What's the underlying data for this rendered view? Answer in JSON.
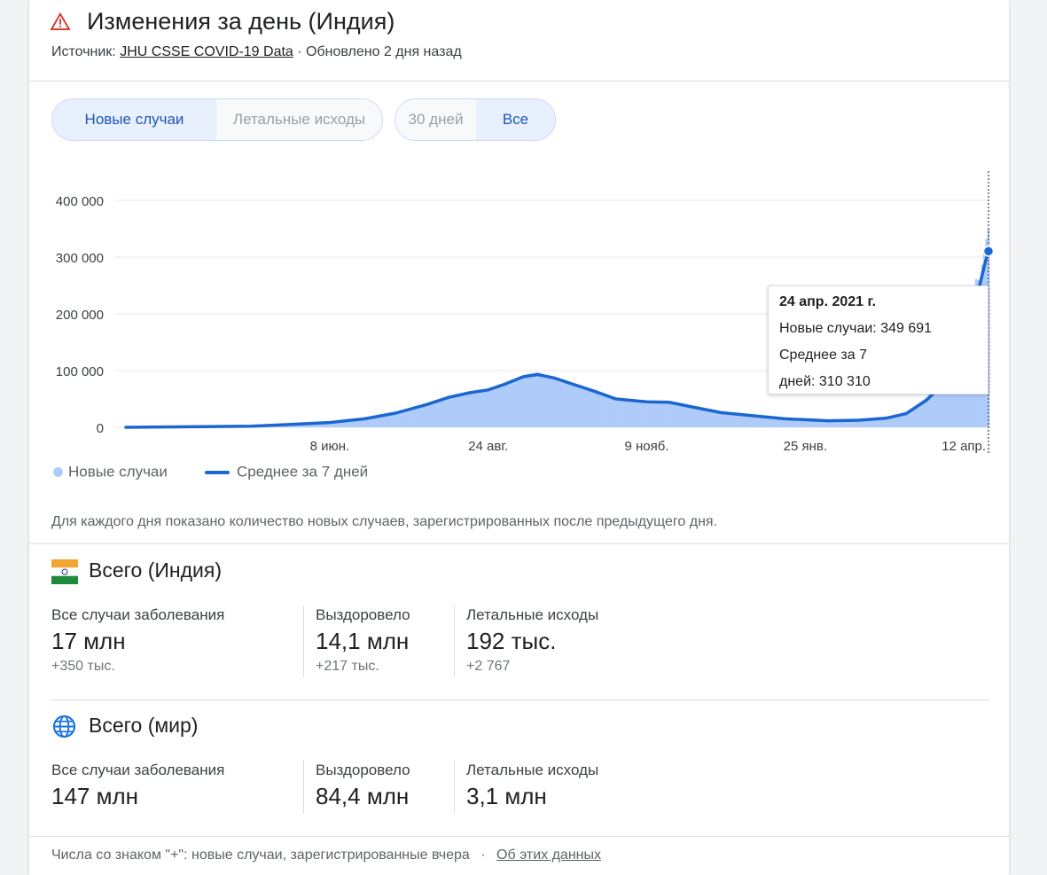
{
  "header": {
    "title": "Изменения за день (Индия)",
    "source_prefix": "Источник:",
    "source_link": "JHU CSSE COVID-19 Data",
    "updated": "· Обновлено 2 дня назад"
  },
  "controls": {
    "metric": [
      {
        "label": "Новые случаи",
        "selected": true
      },
      {
        "label": "Летальные исходы",
        "selected": false
      }
    ],
    "range": [
      {
        "label": "30 дней",
        "selected": false
      },
      {
        "label": "Все",
        "selected": true
      }
    ]
  },
  "tooltip": {
    "date": "24 апр. 2021 г.",
    "new_cases": "Новые случаи: 349 691",
    "avg_line1": "Среднее за 7",
    "avg_line2": "дней: 310 310"
  },
  "legend": {
    "new_cases": "Новые случаи",
    "avg": "Среднее за 7 дней"
  },
  "note": "Для каждого дня показано количество новых случаев, зарегистрированных после предыдущего дня.",
  "totals_india": {
    "title": "Всего (Индия)",
    "stats": [
      {
        "label": "Все случаи заболевания",
        "value": "17 млн",
        "delta": "+350 тыс."
      },
      {
        "label": "Выздоровело",
        "value": "14,1 млн",
        "delta": "+217 тыс."
      },
      {
        "label": "Летальные исходы",
        "value": "192 тыс.",
        "delta": "+2 767"
      }
    ]
  },
  "totals_world": {
    "title": "Всего (мир)",
    "stats": [
      {
        "label": "Все случаи заболевания",
        "value": "147 млн"
      },
      {
        "label": "Выздоровело",
        "value": "84,4 млн"
      },
      {
        "label": "Летальные исходы",
        "value": "3,1 млн"
      }
    ]
  },
  "footer": {
    "text": "Числа со знаком \"+\": новые случаи, зарегистрированные вчера",
    "sep": "·",
    "link": "Об этих данных"
  },
  "colors": {
    "bar": "#aecbfa",
    "line": "#1a67d2",
    "grid": "#e8eaed",
    "accent": "#1a57b0"
  },
  "chart_data": {
    "type": "bar",
    "title": "",
    "xlabel": "",
    "ylabel": "",
    "ylim": [
      0,
      450000
    ],
    "yticks": [
      {
        "value": 0,
        "label": "0"
      },
      {
        "value": 100000,
        "label": "100 000"
      },
      {
        "value": 200000,
        "label": "200 000"
      },
      {
        "value": 300000,
        "label": "300 000"
      },
      {
        "value": 400000,
        "label": "400 000"
      }
    ],
    "xrange": [
      "2020-03-01",
      "2021-04-24"
    ],
    "xticks": [
      {
        "date": "2020-06-08",
        "label": "8 июн."
      },
      {
        "date": "2020-08-24",
        "label": "24 авг."
      },
      {
        "date": "2020-11-09",
        "label": "9 нояб."
      },
      {
        "date": "2021-01-25",
        "label": "25 янв."
      },
      {
        "date": "2021-04-12",
        "label": "12 апр."
      }
    ],
    "series": [
      {
        "name": "Новые случаи",
        "type": "bar",
        "points": [
          [
            "2020-03-01",
            0
          ],
          [
            "2020-04-01",
            1500
          ],
          [
            "2020-05-01",
            2300
          ],
          [
            "2020-05-20",
            5500
          ],
          [
            "2020-06-08",
            9000
          ],
          [
            "2020-06-25",
            16000
          ],
          [
            "2020-07-10",
            27000
          ],
          [
            "2020-07-25",
            42000
          ],
          [
            "2020-08-05",
            55000
          ],
          [
            "2020-08-15",
            63000
          ],
          [
            "2020-08-24",
            67000
          ],
          [
            "2020-09-01",
            78000
          ],
          [
            "2020-09-10",
            92000
          ],
          [
            "2020-09-17",
            97000
          ],
          [
            "2020-09-25",
            86000
          ],
          [
            "2020-10-05",
            75000
          ],
          [
            "2020-10-15",
            63000
          ],
          [
            "2020-10-25",
            50000
          ],
          [
            "2020-11-09",
            45000
          ],
          [
            "2020-11-20",
            45000
          ],
          [
            "2020-12-01",
            36000
          ],
          [
            "2020-12-15",
            25000
          ],
          [
            "2021-01-01",
            20000
          ],
          [
            "2021-01-15",
            15000
          ],
          [
            "2021-01-25",
            13000
          ],
          [
            "2021-02-05",
            11000
          ],
          [
            "2021-02-20",
            13000
          ],
          [
            "2021-03-05",
            17000
          ],
          [
            "2021-03-15",
            26000
          ],
          [
            "2021-03-25",
            53000
          ],
          [
            "2021-04-01",
            81000
          ],
          [
            "2021-04-05",
            103000
          ],
          [
            "2021-04-10",
            152000
          ],
          [
            "2021-04-12",
            168000
          ],
          [
            "2021-04-15",
            217000
          ],
          [
            "2021-04-18",
            261000
          ],
          [
            "2021-04-20",
            259000
          ],
          [
            "2021-04-22",
            314000
          ],
          [
            "2021-04-23",
            332000
          ],
          [
            "2021-04-24",
            349691
          ]
        ]
      },
      {
        "name": "Среднее за 7 дней",
        "type": "line",
        "points": [
          [
            "2020-03-01",
            0
          ],
          [
            "2020-04-01",
            1000
          ],
          [
            "2020-05-01",
            2000
          ],
          [
            "2020-05-20",
            5000
          ],
          [
            "2020-06-08",
            8500
          ],
          [
            "2020-06-25",
            15000
          ],
          [
            "2020-07-10",
            25000
          ],
          [
            "2020-07-25",
            40000
          ],
          [
            "2020-08-05",
            53000
          ],
          [
            "2020-08-15",
            61000
          ],
          [
            "2020-08-24",
            66000
          ],
          [
            "2020-09-01",
            76000
          ],
          [
            "2020-09-10",
            89000
          ],
          [
            "2020-09-17",
            93000
          ],
          [
            "2020-09-25",
            87000
          ],
          [
            "2020-10-05",
            75000
          ],
          [
            "2020-10-15",
            63000
          ],
          [
            "2020-10-25",
            50000
          ],
          [
            "2020-11-09",
            45000
          ],
          [
            "2020-11-20",
            44000
          ],
          [
            "2020-12-01",
            36000
          ],
          [
            "2020-12-15",
            26000
          ],
          [
            "2021-01-01",
            20000
          ],
          [
            "2021-01-15",
            15000
          ],
          [
            "2021-01-25",
            13500
          ],
          [
            "2021-02-05",
            11500
          ],
          [
            "2021-02-20",
            12500
          ],
          [
            "2021-03-05",
            16000
          ],
          [
            "2021-03-15",
            24000
          ],
          [
            "2021-03-25",
            48000
          ],
          [
            "2021-04-01",
            73000
          ],
          [
            "2021-04-05",
            95000
          ],
          [
            "2021-04-10",
            138000
          ],
          [
            "2021-04-12",
            155000
          ],
          [
            "2021-04-15",
            190000
          ],
          [
            "2021-04-18",
            230000
          ],
          [
            "2021-04-20",
            254000
          ],
          [
            "2021-04-22",
            285000
          ],
          [
            "2021-04-23",
            298000
          ],
          [
            "2021-04-24",
            310310
          ]
        ]
      }
    ],
    "selected_point": {
      "date": "2021-04-24",
      "new_cases": 349691,
      "avg7": 310310
    },
    "grid": true,
    "legend_position": "bottom-left"
  }
}
